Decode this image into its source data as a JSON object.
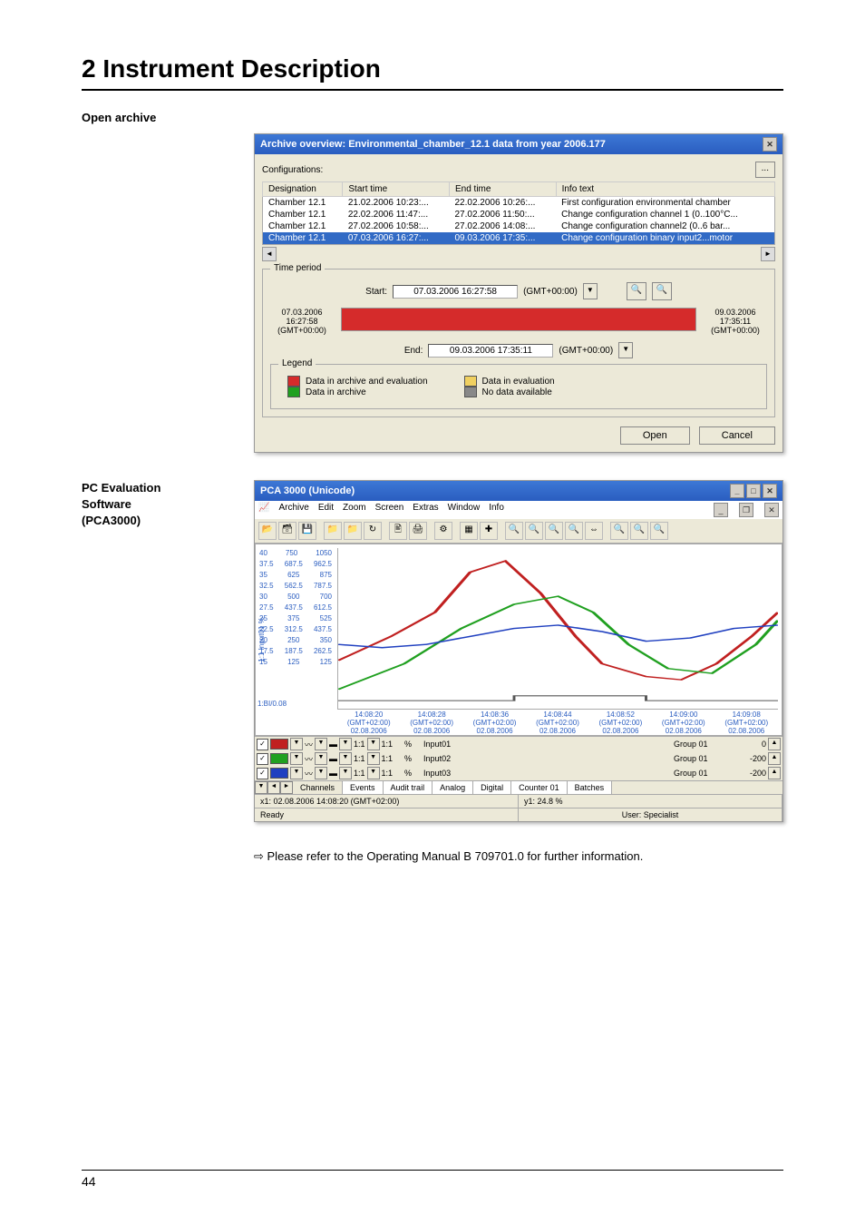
{
  "heading": "2 Instrument Description",
  "sec1": "Open archive",
  "sec2a": "PC Evaluation",
  "sec2b": "Software",
  "sec2c": "(PCA3000)",
  "archive": {
    "title": "Archive overview: Environmental_chamber_12.1 data from year 2006.177",
    "cfg": "Configurations:",
    "dots": "...",
    "cols": {
      "c1": "Designation",
      "c2": "Start time",
      "c3": "End time",
      "c4": "Info text"
    },
    "rows": [
      {
        "d": "Chamber 12.1",
        "s": "21.02.2006 10:23:...",
        "e": "22.02.2006 10:26:...",
        "i": "First configuration environmental chamber"
      },
      {
        "d": "Chamber 12.1",
        "s": "22.02.2006 11:47:...",
        "e": "27.02.2006 11:50:...",
        "i": "Change configuration channel 1 (0..100°C..."
      },
      {
        "d": "Chamber 12.1",
        "s": "27.02.2006 10:58:...",
        "e": "27.02.2006 14:08:...",
        "i": "Change configuration channel2 (0..6 bar..."
      },
      {
        "d": "Chamber 12.1",
        "s": "07.03.2006 16:27:...",
        "e": "09.03.2006 17:35:...",
        "i": "Change configuration binary input2...motor"
      }
    ],
    "tp": "Time period",
    "start": "Start:",
    "start_v": "07.03.2006 16:27:58",
    "tz": "(GMT+00:00)",
    "left1": "07.03.2006",
    "left2": "16:27:58",
    "left3": "(GMT+00:00)",
    "right1": "09.03.2006",
    "right2": "17:35:11",
    "right3": "(GMT+00:00)",
    "end": "End:",
    "end_v": "09.03.2006 17:35:11",
    "legend": "Legend",
    "lg1": "Data in archive and evaluation",
    "lg2": "Data in evaluation",
    "lg3": "Data in archive",
    "lg4": "No data available",
    "open": "Open",
    "cancel": "Cancel"
  },
  "pca": {
    "title": "PCA 3000 (Unicode)",
    "menu": [
      "Archive",
      "Edit",
      "Zoom",
      "Screen",
      "Extras",
      "Window",
      "Info"
    ],
    "yrows": [
      [
        "40",
        "750",
        "1050"
      ],
      [
        "37.5",
        "687.5",
        "962.5"
      ],
      [
        "35",
        "625",
        "875"
      ],
      [
        "32.5",
        "562.5",
        "787.5"
      ],
      [
        "30",
        "500",
        "700"
      ],
      [
        "27.5",
        "437.5",
        "612.5"
      ],
      [
        "25",
        "375",
        "525"
      ],
      [
        "22.5",
        "312.5",
        "437.5"
      ],
      [
        "20",
        "250",
        "350"
      ],
      [
        "17.5",
        "187.5",
        "262.5"
      ],
      [
        "15",
        "125",
        "125"
      ]
    ],
    "ylabel": "1:1 Input01 %",
    "bilabel": "1:BI/0.08",
    "xticks": [
      "14:08:20",
      "14:08:28",
      "14:08:36",
      "14:08:44",
      "14:08:52",
      "14:09:00",
      "14:09:08"
    ],
    "xtz": "(GMT+02:00)",
    "xdate": "02.08.2006",
    "ch": [
      {
        "c": "#c02020",
        "n": "1:1",
        "u": "%",
        "nm": "Input01",
        "g": "Group 01",
        "r": "0"
      },
      {
        "c": "#20a020",
        "n": "1:1",
        "u": "%",
        "nm": "Input02",
        "g": "Group 01",
        "r": "-200"
      },
      {
        "c": "#2040c0",
        "n": "1:1",
        "u": "%",
        "nm": "Input03",
        "g": "Group 01",
        "r": "-200"
      }
    ],
    "tabs": [
      "Channels",
      "Events",
      "Audit trail",
      "Analog",
      "Digital",
      "Counter 01",
      "Batches"
    ],
    "s1": "x1: 02.08.2006 14:08:20 (GMT+02:00)",
    "s2": "y1: 24.8 %",
    "s3": "Ready",
    "s4": "User: Specialist"
  },
  "note": "Please refer to the Operating Manual B 709701.0 for further information.",
  "page": "44"
}
